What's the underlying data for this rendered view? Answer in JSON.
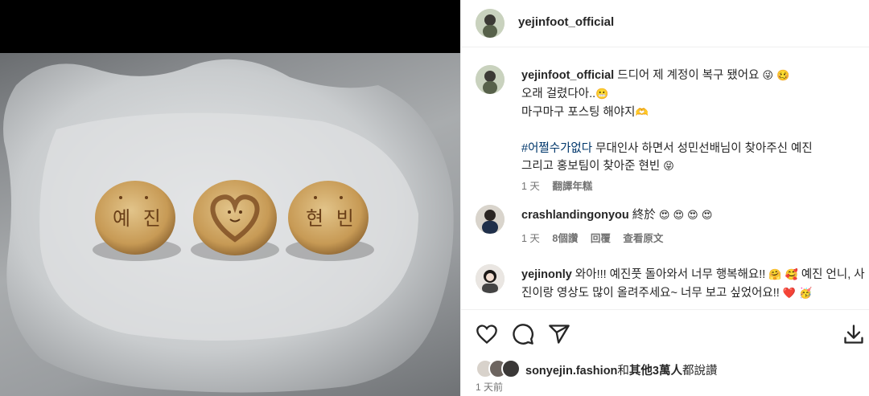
{
  "header": {
    "username": "yejinfoot_official"
  },
  "caption": {
    "username": "yejinfoot_official",
    "line1": "드디어 제 계정이 복구 됐어요",
    "line1_emoji": "😜 🥴",
    "line2": "오래 걸렸다아..",
    "line2_emoji": "😬",
    "line3": "마구마구 포스팅 해야지",
    "line3_emoji": "🫶",
    "hashtag": "#어쩔수가없다",
    "line4": "무대인사 하면서 성민선배님이 찾아주신 예진",
    "line5": "그리고 홍보팀이 찾아준 현빈",
    "line5_emoji": "😝",
    "time": "1 天",
    "translate": "翻譯年糕"
  },
  "comments": [
    {
      "username": "crashlandingonyou",
      "text": "終於",
      "emoji": "😍 😍 😍 😍",
      "time": "1 天",
      "likes": "8個讚",
      "reply": "回覆",
      "translate": "查看原文"
    },
    {
      "username": "yejinonly",
      "text": "와아!!! 예진풋 돌아와서 너무 행복해요!!",
      "emoji": "🤗 🥰",
      "text2": "예진 언니, 사진이랑 영상도 많이 올려주세요~ 너무 보고 싶었어요!!",
      "emoji2": "❤️ 🥳"
    }
  ],
  "actions": {
    "like_icon": "heart-icon",
    "comment_icon": "comment-icon",
    "share_icon": "share-icon",
    "save_icon": "download-icon"
  },
  "likes": {
    "liker": "sonyejin.fashion",
    "connector": "和",
    "others": "其他3萬人",
    "suffix": "都說讚"
  },
  "date": "1 天前",
  "photo": {
    "cake_texts": [
      "예 진",
      "",
      "현 빈"
    ]
  }
}
